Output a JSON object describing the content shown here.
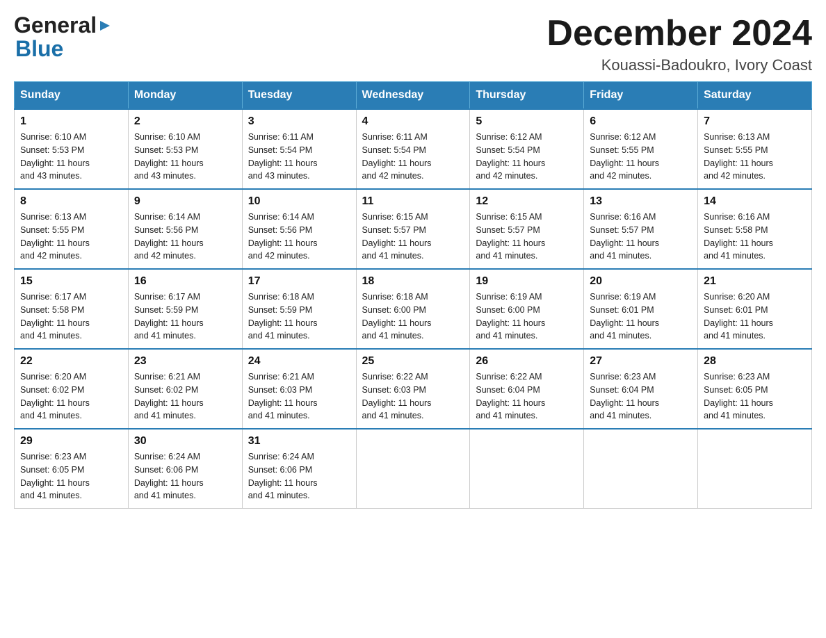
{
  "logo": {
    "general": "General",
    "blue": "Blue"
  },
  "title": {
    "month": "December 2024",
    "location": "Kouassi-Badoukro, Ivory Coast"
  },
  "header": {
    "days": [
      "Sunday",
      "Monday",
      "Tuesday",
      "Wednesday",
      "Thursday",
      "Friday",
      "Saturday"
    ]
  },
  "weeks": [
    [
      {
        "day": "1",
        "info": "Sunrise: 6:10 AM\nSunset: 5:53 PM\nDaylight: 11 hours\nand 43 minutes."
      },
      {
        "day": "2",
        "info": "Sunrise: 6:10 AM\nSunset: 5:53 PM\nDaylight: 11 hours\nand 43 minutes."
      },
      {
        "day": "3",
        "info": "Sunrise: 6:11 AM\nSunset: 5:54 PM\nDaylight: 11 hours\nand 43 minutes."
      },
      {
        "day": "4",
        "info": "Sunrise: 6:11 AM\nSunset: 5:54 PM\nDaylight: 11 hours\nand 42 minutes."
      },
      {
        "day": "5",
        "info": "Sunrise: 6:12 AM\nSunset: 5:54 PM\nDaylight: 11 hours\nand 42 minutes."
      },
      {
        "day": "6",
        "info": "Sunrise: 6:12 AM\nSunset: 5:55 PM\nDaylight: 11 hours\nand 42 minutes."
      },
      {
        "day": "7",
        "info": "Sunrise: 6:13 AM\nSunset: 5:55 PM\nDaylight: 11 hours\nand 42 minutes."
      }
    ],
    [
      {
        "day": "8",
        "info": "Sunrise: 6:13 AM\nSunset: 5:55 PM\nDaylight: 11 hours\nand 42 minutes."
      },
      {
        "day": "9",
        "info": "Sunrise: 6:14 AM\nSunset: 5:56 PM\nDaylight: 11 hours\nand 42 minutes."
      },
      {
        "day": "10",
        "info": "Sunrise: 6:14 AM\nSunset: 5:56 PM\nDaylight: 11 hours\nand 42 minutes."
      },
      {
        "day": "11",
        "info": "Sunrise: 6:15 AM\nSunset: 5:57 PM\nDaylight: 11 hours\nand 41 minutes."
      },
      {
        "day": "12",
        "info": "Sunrise: 6:15 AM\nSunset: 5:57 PM\nDaylight: 11 hours\nand 41 minutes."
      },
      {
        "day": "13",
        "info": "Sunrise: 6:16 AM\nSunset: 5:57 PM\nDaylight: 11 hours\nand 41 minutes."
      },
      {
        "day": "14",
        "info": "Sunrise: 6:16 AM\nSunset: 5:58 PM\nDaylight: 11 hours\nand 41 minutes."
      }
    ],
    [
      {
        "day": "15",
        "info": "Sunrise: 6:17 AM\nSunset: 5:58 PM\nDaylight: 11 hours\nand 41 minutes."
      },
      {
        "day": "16",
        "info": "Sunrise: 6:17 AM\nSunset: 5:59 PM\nDaylight: 11 hours\nand 41 minutes."
      },
      {
        "day": "17",
        "info": "Sunrise: 6:18 AM\nSunset: 5:59 PM\nDaylight: 11 hours\nand 41 minutes."
      },
      {
        "day": "18",
        "info": "Sunrise: 6:18 AM\nSunset: 6:00 PM\nDaylight: 11 hours\nand 41 minutes."
      },
      {
        "day": "19",
        "info": "Sunrise: 6:19 AM\nSunset: 6:00 PM\nDaylight: 11 hours\nand 41 minutes."
      },
      {
        "day": "20",
        "info": "Sunrise: 6:19 AM\nSunset: 6:01 PM\nDaylight: 11 hours\nand 41 minutes."
      },
      {
        "day": "21",
        "info": "Sunrise: 6:20 AM\nSunset: 6:01 PM\nDaylight: 11 hours\nand 41 minutes."
      }
    ],
    [
      {
        "day": "22",
        "info": "Sunrise: 6:20 AM\nSunset: 6:02 PM\nDaylight: 11 hours\nand 41 minutes."
      },
      {
        "day": "23",
        "info": "Sunrise: 6:21 AM\nSunset: 6:02 PM\nDaylight: 11 hours\nand 41 minutes."
      },
      {
        "day": "24",
        "info": "Sunrise: 6:21 AM\nSunset: 6:03 PM\nDaylight: 11 hours\nand 41 minutes."
      },
      {
        "day": "25",
        "info": "Sunrise: 6:22 AM\nSunset: 6:03 PM\nDaylight: 11 hours\nand 41 minutes."
      },
      {
        "day": "26",
        "info": "Sunrise: 6:22 AM\nSunset: 6:04 PM\nDaylight: 11 hours\nand 41 minutes."
      },
      {
        "day": "27",
        "info": "Sunrise: 6:23 AM\nSunset: 6:04 PM\nDaylight: 11 hours\nand 41 minutes."
      },
      {
        "day": "28",
        "info": "Sunrise: 6:23 AM\nSunset: 6:05 PM\nDaylight: 11 hours\nand 41 minutes."
      }
    ],
    [
      {
        "day": "29",
        "info": "Sunrise: 6:23 AM\nSunset: 6:05 PM\nDaylight: 11 hours\nand 41 minutes."
      },
      {
        "day": "30",
        "info": "Sunrise: 6:24 AM\nSunset: 6:06 PM\nDaylight: 11 hours\nand 41 minutes."
      },
      {
        "day": "31",
        "info": "Sunrise: 6:24 AM\nSunset: 6:06 PM\nDaylight: 11 hours\nand 41 minutes."
      },
      {
        "day": "",
        "info": ""
      },
      {
        "day": "",
        "info": ""
      },
      {
        "day": "",
        "info": ""
      },
      {
        "day": "",
        "info": ""
      }
    ]
  ]
}
